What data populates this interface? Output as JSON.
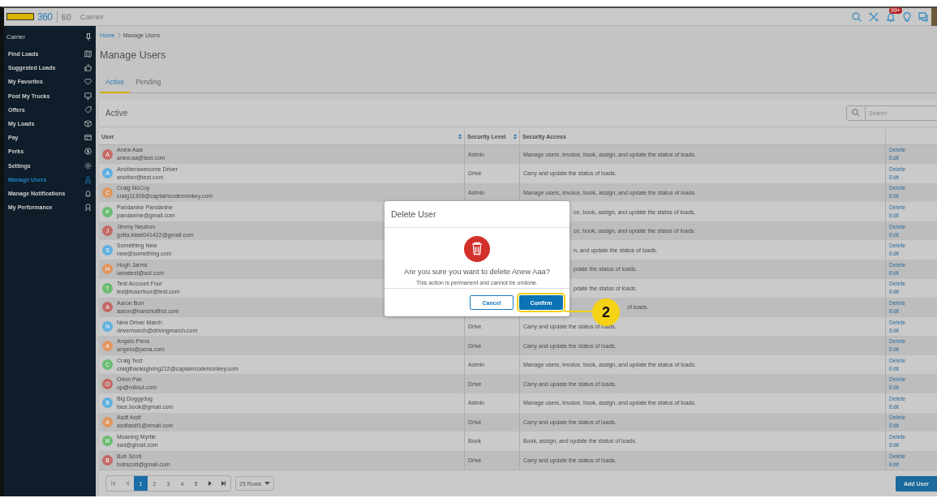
{
  "header": {
    "product": "360",
    "anniversary": "60",
    "app_name": "Carrier",
    "notification_badge": "99+"
  },
  "sidebar": {
    "title": "Carrier",
    "items": [
      {
        "label": "Find Loads",
        "selected": false
      },
      {
        "label": "Suggested Loads",
        "selected": false
      },
      {
        "label": "My Favorites",
        "selected": false
      },
      {
        "label": "Post My Trucks",
        "selected": false
      },
      {
        "label": "Offers",
        "selected": false
      },
      {
        "label": "My Loads",
        "selected": false
      },
      {
        "label": "Pay",
        "selected": false
      },
      {
        "label": "Perks",
        "selected": false
      },
      {
        "label": "Settings",
        "selected": false
      },
      {
        "label": "Manage Users",
        "selected": true
      },
      {
        "label": "Manage Notifications",
        "selected": false
      },
      {
        "label": "My Performance",
        "selected": false
      }
    ]
  },
  "breadcrumb": [
    "Home",
    "Manage Users"
  ],
  "page_title": "Manage Users",
  "tabs": [
    {
      "label": "Active",
      "selected": true
    },
    {
      "label": "Pending",
      "selected": false
    }
  ],
  "card": {
    "title": "Active",
    "search": {
      "placeholder": "Search"
    }
  },
  "table": {
    "columns": [
      {
        "label": "User",
        "sortable": true
      },
      {
        "label": "Security Level",
        "sortable": true
      },
      {
        "label": "Security Access",
        "sortable": false
      }
    ],
    "rows": [
      {
        "kind": "full",
        "avatar": "A",
        "color": "#c26b66",
        "name": "Anew Aaa",
        "email": "anew.aa@test.com",
        "security_level": "Admin",
        "security_access": "Manage users, invoice, book, assign, and update the status of loads.",
        "actions": [
          "Delete",
          "Edit"
        ]
      },
      {
        "kind": "full",
        "avatar": "A",
        "color": "#5fafdd",
        "name": "Anotherawesome Driver",
        "email": "another@test.com",
        "security_level": "Drive",
        "security_access": "Carry and update the status of loads.",
        "actions": [
          "Delete",
          "Edit"
        ]
      },
      {
        "kind": "full",
        "avatar": "C",
        "color": "#df9660",
        "name": "Craig McCoy",
        "email": "craig11308@captaincodemonkey.com",
        "security_level": "Admin",
        "security_access": "Manage users, invoice, book, assign, and update the status of loads.",
        "actions": [
          "Delete",
          "Edit"
        ]
      },
      {
        "kind": "behind_dialog",
        "avatar": "P",
        "color": "#6abb70",
        "name": "Pandanine Pandanine",
        "email": "pandanine@gmail.com",
        "security_access": "ce, book, assign, and update the status of loads.",
        "actions": [
          "Delete",
          "Edit"
        ]
      },
      {
        "kind": "behind_dialog",
        "avatar": "J",
        "color": "#c26b66",
        "name": "Jimmy Neutron",
        "email": "gotta.blast041422@gmail.com",
        "security_access": "ce, book, assign, and update the status of loads.",
        "actions": [
          "Delete",
          "Edit"
        ]
      },
      {
        "kind": "behind_dialog",
        "avatar": "S",
        "color": "#5fafdd",
        "name": "Something New",
        "email": "new@something.com",
        "security_access": "n, and update the status of loads.",
        "actions": [
          "Delete",
          "Edit"
        ]
      },
      {
        "kind": "behind_dialog",
        "avatar": "H",
        "color": "#df9660",
        "name": "Hugh Jarms",
        "email": "iamatest@aol.com",
        "security_access": "pdate the status of loads.",
        "actions": [
          "Delete",
          "Edit"
        ]
      },
      {
        "kind": "behind_dialog",
        "avatar": "T",
        "color": "#6abb70",
        "name": "Test Account Four",
        "email": "testjbiuserfour@test.com",
        "security_access": "pdate the status of loads.",
        "actions": [
          "Delete",
          "Edit"
        ]
      },
      {
        "kind": "behind_badge",
        "avatar": "A",
        "color": "#c26b66",
        "name": "Aaron Burr",
        "email": "aaron@hanshotfirst.com",
        "security_access": "of loads.",
        "actions": [
          "Delete",
          "Edit"
        ]
      },
      {
        "kind": "full",
        "avatar": "N",
        "color": "#5fafdd",
        "name": "New Driver March",
        "email": "drivermarch@drivingmarch.com",
        "security_level": "Drive",
        "security_access": "Carry and update the status of loads.",
        "actions": [
          "Delete",
          "Edit"
        ]
      },
      {
        "kind": "full",
        "avatar": "A",
        "color": "#df9660",
        "name": "Angelo Pena",
        "email": "angelo@pena.com",
        "security_level": "Drive",
        "security_access": "Carry and update the status of loads.",
        "actions": [
          "Delete",
          "Edit"
        ]
      },
      {
        "kind": "full",
        "avatar": "C",
        "color": "#6abb70",
        "name": "Craig Test",
        "email": "craigthanksgiving212@captaincodemonkey.com",
        "security_level": "Admin",
        "security_access": "Manage users, invoice, book, assign, and update the status of loads.",
        "actions": [
          "Delete",
          "Edit"
        ]
      },
      {
        "kind": "full",
        "avatar": "O",
        "color": "#c26b66",
        "name": "Orion Pax",
        "email": "op@rollout.com",
        "security_level": "Drive",
        "security_access": "Carry and update the status of loads.",
        "actions": [
          "Delete",
          "Edit"
        ]
      },
      {
        "kind": "full",
        "avatar": "B",
        "color": "#5fafdd",
        "name": "Big Doggydog",
        "email": "face.book@gmail.com",
        "security_level": "Admin",
        "security_access": "Manage users, invoice, book, assign, and update the status of loads.",
        "actions": [
          "Delete",
          "Edit"
        ]
      },
      {
        "kind": "full",
        "avatar": "A",
        "color": "#df9660",
        "name": "Asdf Asdf",
        "email": "asdfasdf1@email.com",
        "security_level": "Drive",
        "security_access": "Carry and update the status of loads.",
        "actions": [
          "Delete",
          "Edit"
        ]
      },
      {
        "kind": "full",
        "avatar": "M",
        "color": "#6abb70",
        "name": "Moaning Myrtle",
        "email": "sad@ghost.com",
        "security_level": "Book",
        "security_access": "Book, assign, and update the status of loads.",
        "actions": [
          "Delete",
          "Edit"
        ]
      },
      {
        "kind": "full",
        "avatar": "B",
        "color": "#c26b66",
        "name": "Bob Scott",
        "email": "bobscott@gmail.com",
        "security_level": "Drive",
        "security_access": "Carry and update the status of loads.",
        "actions": [
          "Delete",
          "Edit"
        ]
      }
    ]
  },
  "pagination": {
    "pages": [
      {
        "label": "1",
        "selected": true
      },
      {
        "label": "2",
        "selected": false
      },
      {
        "label": "3",
        "selected": false
      },
      {
        "label": "4",
        "selected": false
      },
      {
        "label": "5",
        "selected": false
      }
    ],
    "rows_per_page": "25 Rows"
  },
  "add_user_button": "Add User",
  "dialog": {
    "title": "Delete User",
    "question": "Are you sure you want to delete Anew Aaa?",
    "note": "This action is permanent and cannot be undone.",
    "cancel": "Cancel",
    "confirm": "Confirm",
    "confirm_highlighted": true
  },
  "annotation": {
    "step": "2"
  }
}
